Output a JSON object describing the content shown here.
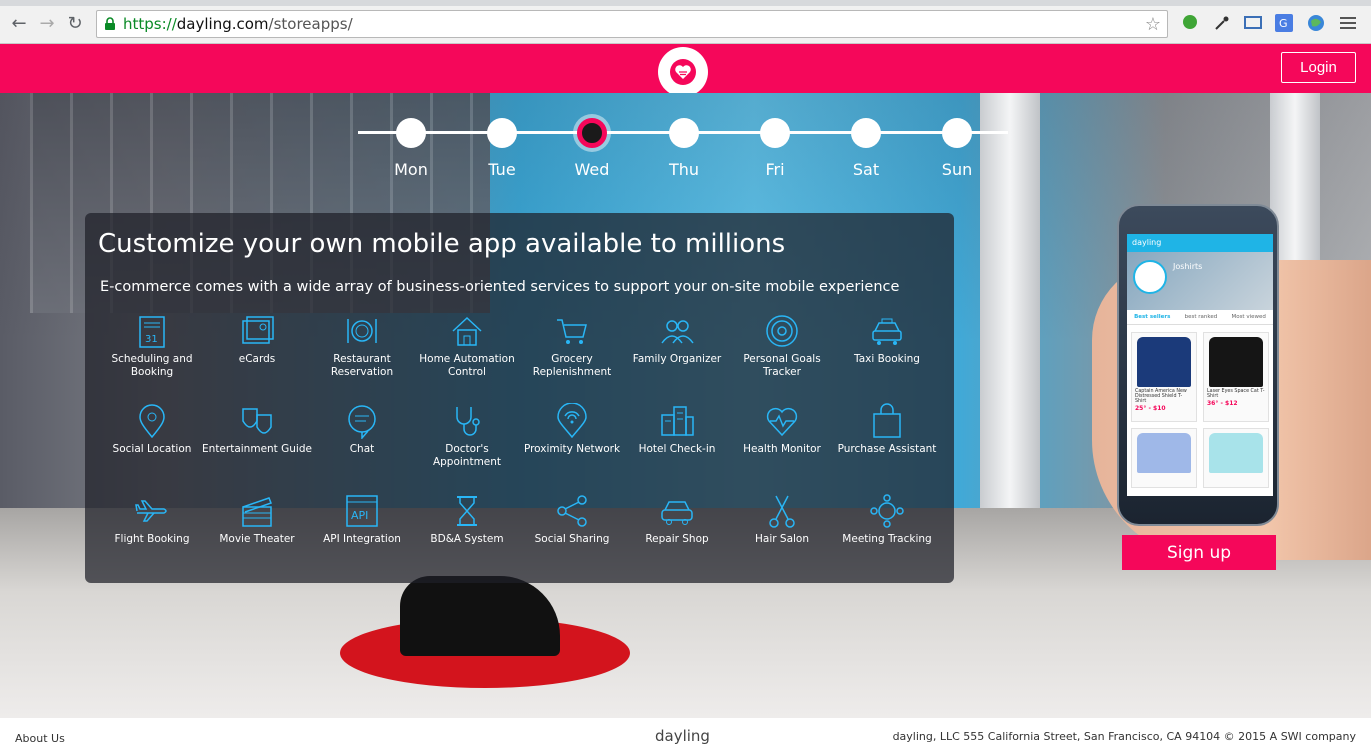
{
  "browser": {
    "url_scheme": "https://",
    "url_host": "dayling.com",
    "url_path": "/storeapps/"
  },
  "header": {
    "login_label": "Login",
    "brand_color": "#f5075a"
  },
  "days": {
    "items": [
      "Mon",
      "Tue",
      "Wed",
      "Thu",
      "Fri",
      "Sat",
      "Sun"
    ],
    "selected": "Wed"
  },
  "panel": {
    "headline": "Customize your own mobile app available to millions",
    "subheadline": "E-commerce comes with a wide array of business-oriented services to support your on-site mobile experience",
    "services": [
      {
        "label": "Scheduling and Booking",
        "icon": "calendar-icon"
      },
      {
        "label": "eCards",
        "icon": "ecard-icon"
      },
      {
        "label": "Restaurant Reservation",
        "icon": "plate-icon"
      },
      {
        "label": "Home Automation Control",
        "icon": "house-icon"
      },
      {
        "label": "Grocery Replenishment",
        "icon": "cart-icon"
      },
      {
        "label": "Family Organizer",
        "icon": "family-icon"
      },
      {
        "label": "Personal Goals Tracker",
        "icon": "target-icon"
      },
      {
        "label": "Taxi Booking",
        "icon": "taxi-icon"
      },
      {
        "label": "Social Location",
        "icon": "location-pin-icon"
      },
      {
        "label": "Entertainment Guide",
        "icon": "theater-masks-icon"
      },
      {
        "label": "Chat",
        "icon": "chat-icon"
      },
      {
        "label": "Doctor's Appointment",
        "icon": "stethoscope-icon"
      },
      {
        "label": "Proximity Network",
        "icon": "proximity-icon"
      },
      {
        "label": "Hotel Check-in",
        "icon": "hotel-icon"
      },
      {
        "label": "Health Monitor",
        "icon": "heart-pulse-icon"
      },
      {
        "label": "Purchase Assistant",
        "icon": "shopping-bag-icon"
      },
      {
        "label": "Flight Booking",
        "icon": "airplane-icon"
      },
      {
        "label": "Movie Theater",
        "icon": "clapperboard-icon"
      },
      {
        "label": "API Integration",
        "icon": "api-icon"
      },
      {
        "label": "BD&A System",
        "icon": "hourglass-icon"
      },
      {
        "label": "Social Sharing",
        "icon": "share-icon"
      },
      {
        "label": "Repair Shop",
        "icon": "car-icon"
      },
      {
        "label": "Hair Salon",
        "icon": "scissors-icon"
      },
      {
        "label": "Meeting Tracking",
        "icon": "meeting-icon"
      }
    ]
  },
  "phone": {
    "app_name": "dayling",
    "store_name": "Joshirts",
    "tabs": [
      "Best sellers",
      "best ranked",
      "Most viewed"
    ],
    "products": [
      {
        "title": "Captain America New Distressed Shield T-Shirt",
        "price": "25° - $10"
      },
      {
        "title": "Laser Eyes Space Cat T-Shirt",
        "price": "36° - $12"
      }
    ]
  },
  "signup_label": "Sign up",
  "footer": {
    "about": "About Us",
    "brand": "dayling",
    "address": "dayling, LLC 555 California Street, San Francisco, CA 94104 © 2015 A SWI company"
  }
}
